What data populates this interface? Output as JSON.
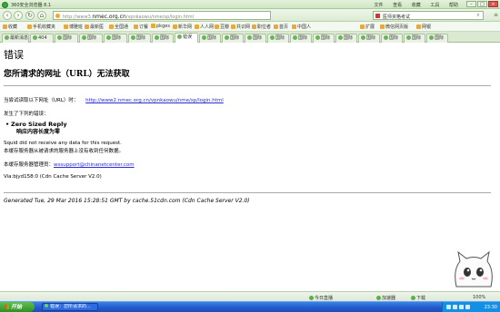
{
  "window": {
    "title": "360安全浏览器 8.1",
    "menus": [
      "文件",
      "查看",
      "收藏",
      "工具",
      "帮助"
    ]
  },
  "toolbar": {
    "url_prefix": "http://www3.",
    "url_host": "nmec.org.cn",
    "url_path": "/vpnkaowu/nme/sp/login.html",
    "search_text": "医师资格考试"
  },
  "favorites": [
    "收藏",
    "手机收藏夹",
    "博雅班",
    "最新医",
    "全国通",
    "订餐",
    "pkges",
    "新华网",
    "人人网",
    "豆瓣",
    "共识网",
    "职位者",
    "首页",
    "中国人",
    "扩展",
    "微信网页版",
    "网银"
  ],
  "tabs": [
    "最新消息",
    "404",
    "国际",
    "国际",
    "国际",
    "错误",
    "国际",
    "国际",
    "国际",
    "国际",
    "国际",
    "国际",
    "国际",
    "国际",
    "国际",
    "国际",
    "国际",
    "国际",
    "国际"
  ],
  "page": {
    "heading": "错误",
    "subheading": "您所请求的网址（URL）无法获取",
    "attempt_label": "当尝试读取以下网址（URL）时：",
    "attempt_url": "http://www2.nmec.org.cn/vpnkaowu/nme/sp/login.html",
    "error_occurred": "发生了下列的错误：",
    "error_title": "Zero Sized Reply",
    "error_subtitle": "响应内容长度为零",
    "squid_msg": "Squid did not receive any data for this request.",
    "squid_msg_cn": "本缓存服务器从被请求的服务器上没有收到任何数据。",
    "admin_label": "本缓存服务器管理员：",
    "admin_email": "wssupport@chinanetcenter.com",
    "via": "Via:bjyd158:0 (Cdn Cache Server V2.0)",
    "generated": "Generated Tue, 29 Mar 2016 15:28:51 GMT by cache.51cdn.com (Cdn Cache Server V2.0)"
  },
  "statusbar": {
    "items": [
      "今日直播",
      "加速器",
      "下载",
      "100%"
    ]
  },
  "taskbar": {
    "start_label": "开始",
    "task_label": "错误：您所请求的...",
    "clock": "23:30"
  },
  "colors": {
    "link": "#2a2ad4",
    "browser_chrome": "#dcebd3",
    "taskbar": "#2258c8"
  }
}
